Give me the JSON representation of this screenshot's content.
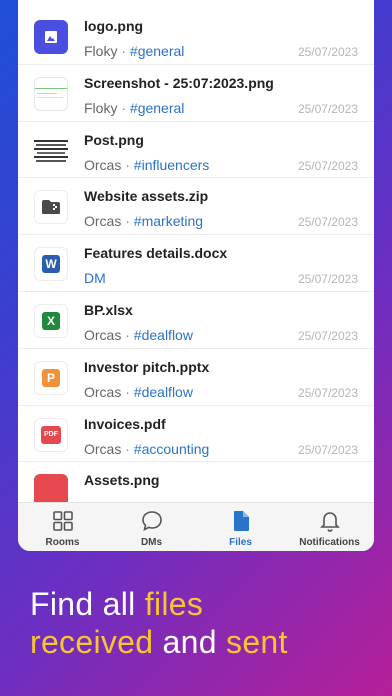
{
  "files": [
    {
      "name": "logo.png",
      "sender": "Floky",
      "channel": "#general",
      "date": "25/07/2023",
      "thumb": "image-icon",
      "thumb_color": "#4a4fe0"
    },
    {
      "name": "Screenshot - 25:07:2023.png",
      "sender": "Floky",
      "channel": "#general",
      "date": "25/07/2023",
      "thumb": "screenshot",
      "thumb_color": "#ffffff"
    },
    {
      "name": "Post.png",
      "sender": "Orcas",
      "channel": "#influencers",
      "date": "25/07/2023",
      "thumb": "post",
      "thumb_color": "#ffffff"
    },
    {
      "name": "Website assets.zip",
      "sender": "Orcas",
      "channel": "#marketing",
      "date": "25/07/2023",
      "thumb": "zip-icon",
      "thumb_color": "#ffffff"
    },
    {
      "name": "Features details.docx",
      "sender": "",
      "channel": "DM",
      "date": "25/07/2023",
      "thumb": "word-icon",
      "thumb_color": "#2b5ead"
    },
    {
      "name": "BP.xlsx",
      "sender": "Orcas",
      "channel": "#dealflow",
      "date": "25/07/2023",
      "thumb": "excel-icon",
      "thumb_color": "#1f8a3e"
    },
    {
      "name": "Investor pitch.pptx",
      "sender": "Orcas",
      "channel": "#dealflow",
      "date": "25/07/2023",
      "thumb": "powerpoint-icon",
      "thumb_color": "#f0923a"
    },
    {
      "name": "Invoices.pdf",
      "sender": "Orcas",
      "channel": "#accounting",
      "date": "25/07/2023",
      "thumb": "pdf-icon",
      "thumb_color": "#e5484d"
    },
    {
      "name": "Assets.png",
      "sender": "",
      "channel": "",
      "date": "",
      "thumb": "image",
      "thumb_color": "#e5484d"
    }
  ],
  "separator": "·",
  "tabs": [
    {
      "label": "Rooms",
      "icon": "grid-icon"
    },
    {
      "label": "DMs",
      "icon": "chat-bubble-icon"
    },
    {
      "label": "Files",
      "icon": "file-icon",
      "active": true
    },
    {
      "label": "Notifications",
      "icon": "bell-icon"
    }
  ],
  "headline": {
    "line1_a": "Find all ",
    "line1_b": "files",
    "line2_a": "received",
    "line2_b": " and ",
    "line2_c": "sent"
  },
  "colors": {
    "accent": "#2b72c9",
    "highlight": "#f7c531"
  }
}
